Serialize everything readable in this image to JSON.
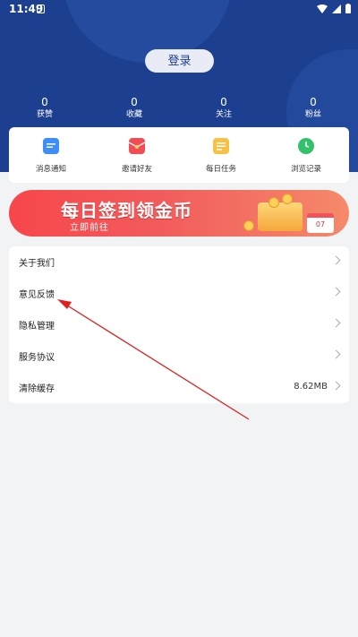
{
  "status_bar": {
    "time": "11:49"
  },
  "header": {
    "login_label": "登录"
  },
  "stats": [
    {
      "value": "0",
      "label": "获赞"
    },
    {
      "value": "0",
      "label": "收藏"
    },
    {
      "value": "0",
      "label": "关注"
    },
    {
      "value": "0",
      "label": "粉丝"
    }
  ],
  "quick_actions": [
    {
      "label": "消息通知",
      "icon": "message-icon",
      "color": "#3d8ef7"
    },
    {
      "label": "邀请好友",
      "icon": "red-envelope-icon",
      "color": "#f24d57"
    },
    {
      "label": "每日任务",
      "icon": "task-list-icon",
      "color": "#f6c144"
    },
    {
      "label": "浏览记录",
      "icon": "clock-icon",
      "color": "#35c16b"
    }
  ],
  "banner": {
    "title": "每日签到领金币",
    "subtitle": "立即前往",
    "calendar_day": "07"
  },
  "menu": [
    {
      "label": "关于我们",
      "value": ""
    },
    {
      "label": "意见反馈",
      "value": ""
    },
    {
      "label": "隐私管理",
      "value": ""
    },
    {
      "label": "服务协议",
      "value": ""
    },
    {
      "label": "清除缓存",
      "value": "8.62MB"
    }
  ],
  "colors": {
    "header_bg": "#1d3f8f",
    "annotation_arrow": "#e02020"
  }
}
